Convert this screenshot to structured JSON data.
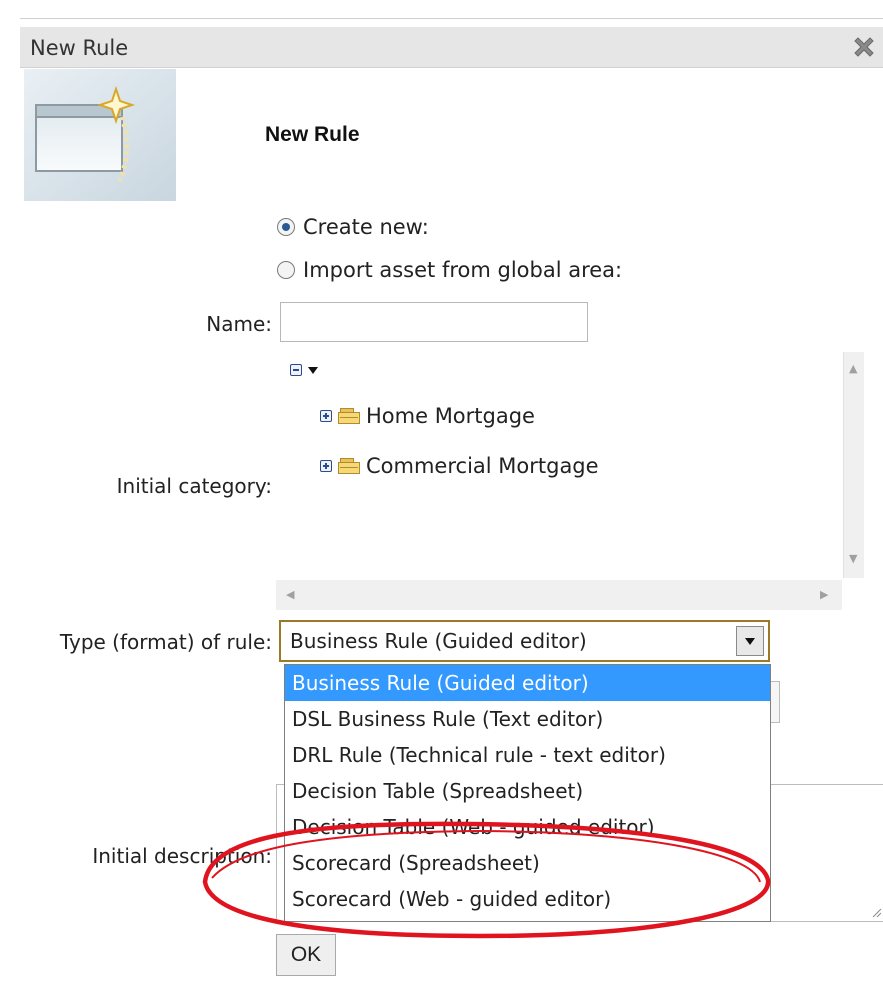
{
  "dialog": {
    "title": "New Rule"
  },
  "wizard": {
    "header": "New Rule"
  },
  "options": {
    "create_new": "Create new:",
    "import_global": "Import asset from global area:"
  },
  "form": {
    "name_label": "Name:",
    "name_value": "",
    "category_label": "Initial category:",
    "type_label": "Type (format) of rule:",
    "description_label": "Initial description:",
    "ok_label": "OK"
  },
  "categories": [
    "Home Mortgage",
    "Commercial Mortgage"
  ],
  "rule_type": {
    "selected": "Business Rule (Guided editor)",
    "options": [
      "Business Rule (Guided editor)",
      "DSL Business Rule (Text editor)",
      "DRL Rule (Technical rule - text editor)",
      "Decision Table (Spreadsheet)",
      "Decision Table (Web - guided editor)",
      "Scorecard (Spreadsheet)",
      "Scorecard (Web - guided editor)"
    ]
  },
  "colors": {
    "highlight": "#3399ff",
    "annotation": "#e0141e",
    "titlebar": "#e6e6e6"
  },
  "icons": {
    "close": "close-icon",
    "wizard": "new-window-wizard-icon",
    "folder": "folder-icon"
  }
}
